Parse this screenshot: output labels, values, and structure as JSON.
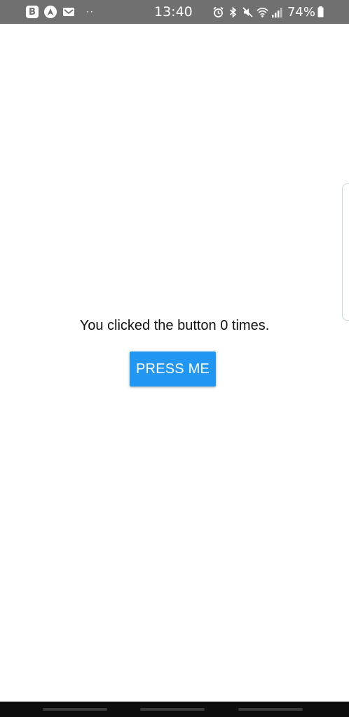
{
  "status_bar": {
    "time": "13:40",
    "battery": "74%",
    "left_icons": [
      "b-icon",
      "navigation-icon",
      "mail-icon"
    ],
    "more_indicator": "··",
    "right_icons": [
      "alarm-icon",
      "bluetooth-icon",
      "mute-icon",
      "wifi-icon",
      "signal-icon",
      "battery-icon"
    ]
  },
  "main": {
    "counter_text": "You clicked the button 0 times.",
    "button_label": "PRESS ME"
  },
  "colors": {
    "status_bar_bg": "#707070",
    "button_bg": "#2196f3",
    "nav_bar_bg": "#0d0d0d"
  }
}
